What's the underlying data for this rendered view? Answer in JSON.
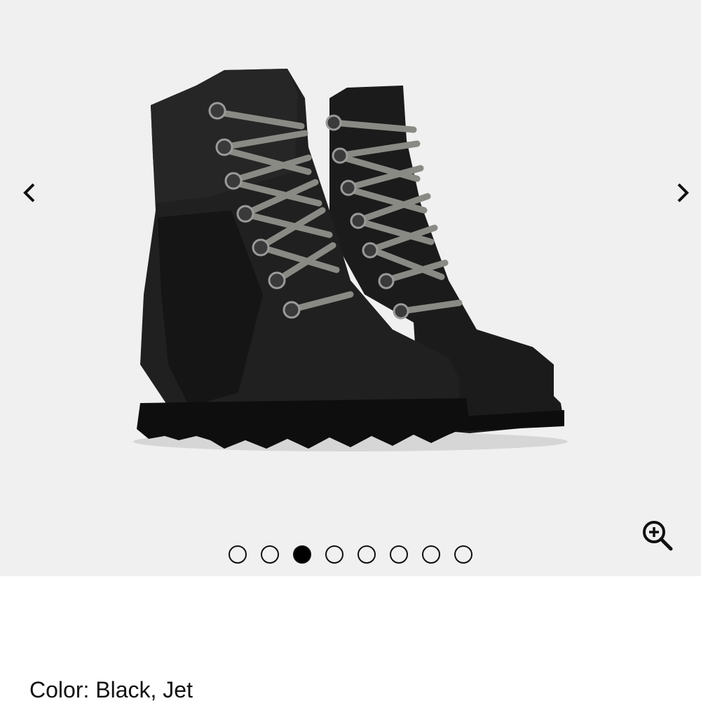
{
  "gallery": {
    "image_alt": "Black lace-up wedge boots",
    "prev_icon": "chevron-left-icon",
    "next_icon": "chevron-right-icon",
    "zoom_icon": "zoom-in-icon",
    "total_images": 8,
    "active_index": 2,
    "dots": [
      {
        "label": "Image 1"
      },
      {
        "label": "Image 2"
      },
      {
        "label": "Image 3"
      },
      {
        "label": "Image 4"
      },
      {
        "label": "Image 5"
      },
      {
        "label": "Image 6"
      },
      {
        "label": "Image 7"
      },
      {
        "label": "Image 8"
      }
    ]
  },
  "product": {
    "color_label": "Color:",
    "color_value": "Black, Jet"
  },
  "colors": {
    "gallery_bg": "#f0f0f0",
    "text": "#111111",
    "active_dot": "#000000"
  }
}
